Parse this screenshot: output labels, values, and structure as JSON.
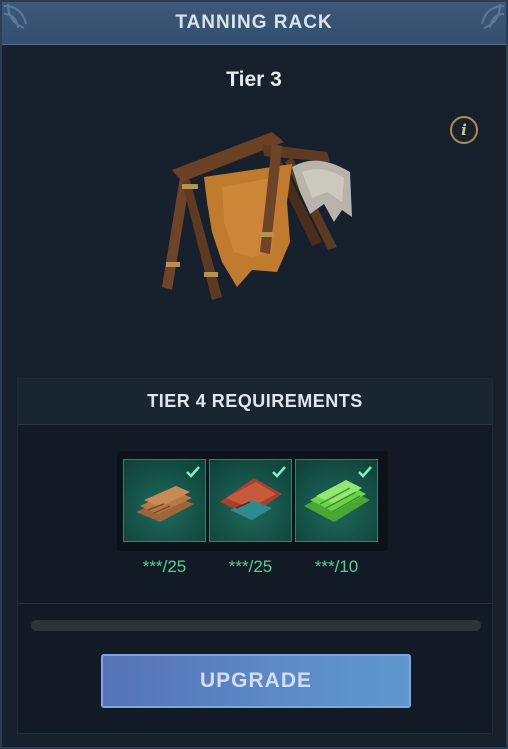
{
  "header": {
    "title": "TANNING RACK"
  },
  "building": {
    "tier_label": "Tier 3",
    "icon": "tanning-rack-image"
  },
  "info_button": {
    "label": "i",
    "icon": "info-icon"
  },
  "requirements": {
    "title": "TIER 4 REQUIREMENTS",
    "items": [
      {
        "icon": "leather-icon",
        "count": "***/25",
        "met": true
      },
      {
        "icon": "red-hide-icon",
        "count": "***/25",
        "met": true
      },
      {
        "icon": "green-scale-leather-icon",
        "count": "***/10",
        "met": true
      }
    ],
    "progress": 0
  },
  "upgrade_button": {
    "label": "UPGRADE"
  },
  "colors": {
    "accent_green": "#4dd392",
    "header_blue": "#3d5878",
    "button_blue": "#5c89c7",
    "info_gold": "#b08b4f"
  }
}
